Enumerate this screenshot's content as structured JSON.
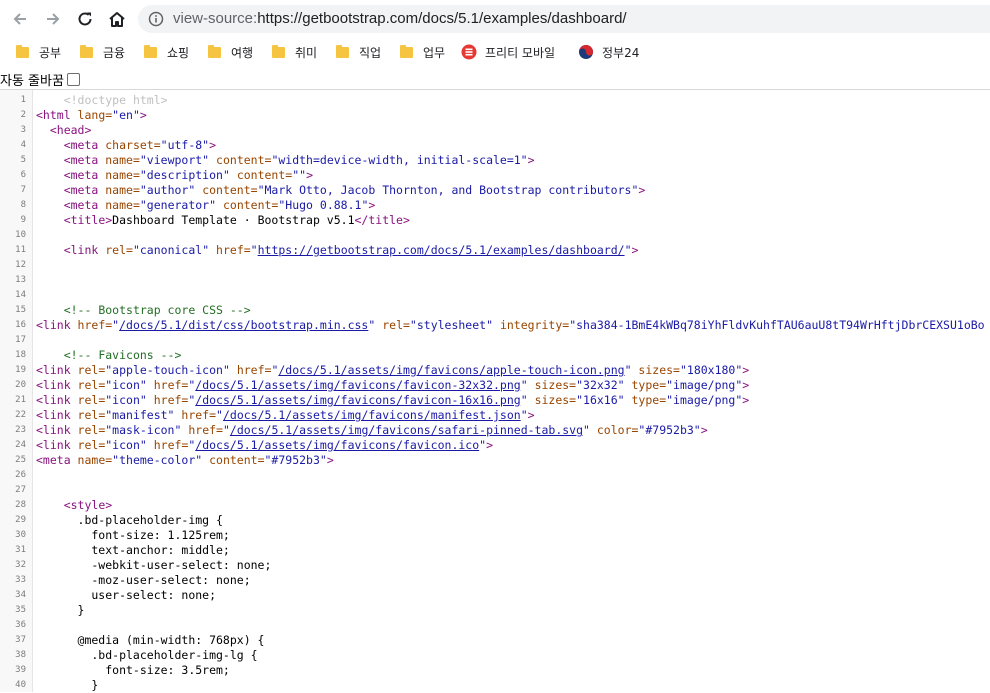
{
  "toolbar": {
    "scheme": "view-source:",
    "url_rest": "https://getbootstrap.com/docs/5.1/examples/dashboard/"
  },
  "bookmarks": [
    {
      "label": "공부",
      "icon": "folder-icon"
    },
    {
      "label": "금융",
      "icon": "folder-icon"
    },
    {
      "label": "쇼핑",
      "icon": "folder-icon"
    },
    {
      "label": "여행",
      "icon": "folder-icon"
    },
    {
      "label": "취미",
      "icon": "folder-icon"
    },
    {
      "label": "직업",
      "icon": "folder-icon"
    },
    {
      "label": "업무",
      "icon": "folder-icon"
    },
    {
      "label": "프리티 모바일",
      "icon": "pretty-mobile-icon"
    },
    {
      "label": "정부24",
      "icon": "korea-gov-icon"
    }
  ],
  "wrap_toggle": {
    "label": "자동 줄바꿈",
    "checked": false
  },
  "source": {
    "lines": [
      {
        "n": "1",
        "tokens": [
          {
            "t": "    ",
            "k": "p"
          },
          {
            "t": "<!doctype html>",
            "k": "d"
          }
        ]
      },
      {
        "n": "2",
        "tokens": [
          {
            "t": "<html ",
            "k": "t"
          },
          {
            "t": "lang=",
            "k": "a"
          },
          {
            "t": "\"en\"",
            "k": "v"
          },
          {
            "t": ">",
            "k": "t"
          }
        ]
      },
      {
        "n": "3",
        "tokens": [
          {
            "t": "  ",
            "k": "p"
          },
          {
            "t": "<head>",
            "k": "t"
          }
        ]
      },
      {
        "n": "4",
        "tokens": [
          {
            "t": "    ",
            "k": "p"
          },
          {
            "t": "<meta ",
            "k": "t"
          },
          {
            "t": "charset=",
            "k": "a"
          },
          {
            "t": "\"utf-8\"",
            "k": "v"
          },
          {
            "t": ">",
            "k": "t"
          }
        ]
      },
      {
        "n": "5",
        "tokens": [
          {
            "t": "    ",
            "k": "p"
          },
          {
            "t": "<meta ",
            "k": "t"
          },
          {
            "t": "name=",
            "k": "a"
          },
          {
            "t": "\"viewport\" ",
            "k": "v"
          },
          {
            "t": "content=",
            "k": "a"
          },
          {
            "t": "\"width=device-width, initial-scale=1\"",
            "k": "v"
          },
          {
            "t": ">",
            "k": "t"
          }
        ]
      },
      {
        "n": "6",
        "tokens": [
          {
            "t": "    ",
            "k": "p"
          },
          {
            "t": "<meta ",
            "k": "t"
          },
          {
            "t": "name=",
            "k": "a"
          },
          {
            "t": "\"description\" ",
            "k": "v"
          },
          {
            "t": "content=",
            "k": "a"
          },
          {
            "t": "\"\"",
            "k": "v"
          },
          {
            "t": ">",
            "k": "t"
          }
        ]
      },
      {
        "n": "7",
        "tokens": [
          {
            "t": "    ",
            "k": "p"
          },
          {
            "t": "<meta ",
            "k": "t"
          },
          {
            "t": "name=",
            "k": "a"
          },
          {
            "t": "\"author\" ",
            "k": "v"
          },
          {
            "t": "content=",
            "k": "a"
          },
          {
            "t": "\"Mark Otto, Jacob Thornton, and Bootstrap contributors\"",
            "k": "v"
          },
          {
            "t": ">",
            "k": "t"
          }
        ]
      },
      {
        "n": "8",
        "tokens": [
          {
            "t": "    ",
            "k": "p"
          },
          {
            "t": "<meta ",
            "k": "t"
          },
          {
            "t": "name=",
            "k": "a"
          },
          {
            "t": "\"generator\" ",
            "k": "v"
          },
          {
            "t": "content=",
            "k": "a"
          },
          {
            "t": "\"Hugo 0.88.1\"",
            "k": "v"
          },
          {
            "t": ">",
            "k": "t"
          }
        ]
      },
      {
        "n": "9",
        "tokens": [
          {
            "t": "    ",
            "k": "p"
          },
          {
            "t": "<title>",
            "k": "t"
          },
          {
            "t": "Dashboard Template · Bootstrap v5.1",
            "k": "p"
          },
          {
            "t": "</title>",
            "k": "t"
          }
        ]
      },
      {
        "n": "10",
        "tokens": []
      },
      {
        "n": "11",
        "tokens": [
          {
            "t": "    ",
            "k": "p"
          },
          {
            "t": "<link ",
            "k": "t"
          },
          {
            "t": "rel=",
            "k": "a"
          },
          {
            "t": "\"canonical\" ",
            "k": "v"
          },
          {
            "t": "href=",
            "k": "a"
          },
          {
            "t": "\"",
            "k": "v"
          },
          {
            "t": "https://getbootstrap.com/docs/5.1/examples/dashboard/",
            "k": "l"
          },
          {
            "t": "\"",
            "k": "v"
          },
          {
            "t": ">",
            "k": "t"
          }
        ]
      },
      {
        "n": "12",
        "tokens": []
      },
      {
        "n": "13",
        "tokens": []
      },
      {
        "n": "14",
        "tokens": []
      },
      {
        "n": "15",
        "tokens": [
          {
            "t": "    ",
            "k": "p"
          },
          {
            "t": "<!-- Bootstrap core CSS -->",
            "k": "c"
          }
        ]
      },
      {
        "n": "16",
        "tokens": [
          {
            "t": "<link ",
            "k": "t"
          },
          {
            "t": "href=",
            "k": "a"
          },
          {
            "t": "\"",
            "k": "v"
          },
          {
            "t": "/docs/5.1/dist/css/bootstrap.min.css",
            "k": "l"
          },
          {
            "t": "\" ",
            "k": "v"
          },
          {
            "t": "rel=",
            "k": "a"
          },
          {
            "t": "\"stylesheet\" ",
            "k": "v"
          },
          {
            "t": "integrity=",
            "k": "a"
          },
          {
            "t": "\"sha384-1BmE4kWBq78iYhFldvKuhfTAU6auU8tT94WrHftjDbrCEXSU1oBo",
            "k": "v"
          }
        ]
      },
      {
        "n": "17",
        "tokens": []
      },
      {
        "n": "18",
        "tokens": [
          {
            "t": "    ",
            "k": "p"
          },
          {
            "t": "<!-- Favicons -->",
            "k": "c"
          }
        ]
      },
      {
        "n": "19",
        "tokens": [
          {
            "t": "<link ",
            "k": "t"
          },
          {
            "t": "rel=",
            "k": "a"
          },
          {
            "t": "\"apple-touch-icon\" ",
            "k": "v"
          },
          {
            "t": "href=",
            "k": "a"
          },
          {
            "t": "\"",
            "k": "v"
          },
          {
            "t": "/docs/5.1/assets/img/favicons/apple-touch-icon.png",
            "k": "l"
          },
          {
            "t": "\" ",
            "k": "v"
          },
          {
            "t": "sizes=",
            "k": "a"
          },
          {
            "t": "\"180x180\"",
            "k": "v"
          },
          {
            "t": ">",
            "k": "t"
          }
        ]
      },
      {
        "n": "20",
        "tokens": [
          {
            "t": "<link ",
            "k": "t"
          },
          {
            "t": "rel=",
            "k": "a"
          },
          {
            "t": "\"icon\" ",
            "k": "v"
          },
          {
            "t": "href=",
            "k": "a"
          },
          {
            "t": "\"",
            "k": "v"
          },
          {
            "t": "/docs/5.1/assets/img/favicons/favicon-32x32.png",
            "k": "l"
          },
          {
            "t": "\" ",
            "k": "v"
          },
          {
            "t": "sizes=",
            "k": "a"
          },
          {
            "t": "\"32x32\" ",
            "k": "v"
          },
          {
            "t": "type=",
            "k": "a"
          },
          {
            "t": "\"image/png\"",
            "k": "v"
          },
          {
            "t": ">",
            "k": "t"
          }
        ]
      },
      {
        "n": "21",
        "tokens": [
          {
            "t": "<link ",
            "k": "t"
          },
          {
            "t": "rel=",
            "k": "a"
          },
          {
            "t": "\"icon\" ",
            "k": "v"
          },
          {
            "t": "href=",
            "k": "a"
          },
          {
            "t": "\"",
            "k": "v"
          },
          {
            "t": "/docs/5.1/assets/img/favicons/favicon-16x16.png",
            "k": "l"
          },
          {
            "t": "\" ",
            "k": "v"
          },
          {
            "t": "sizes=",
            "k": "a"
          },
          {
            "t": "\"16x16\" ",
            "k": "v"
          },
          {
            "t": "type=",
            "k": "a"
          },
          {
            "t": "\"image/png\"",
            "k": "v"
          },
          {
            "t": ">",
            "k": "t"
          }
        ]
      },
      {
        "n": "22",
        "tokens": [
          {
            "t": "<link ",
            "k": "t"
          },
          {
            "t": "rel=",
            "k": "a"
          },
          {
            "t": "\"manifest\" ",
            "k": "v"
          },
          {
            "t": "href=",
            "k": "a"
          },
          {
            "t": "\"",
            "k": "v"
          },
          {
            "t": "/docs/5.1/assets/img/favicons/manifest.json",
            "k": "l"
          },
          {
            "t": "\"",
            "k": "v"
          },
          {
            "t": ">",
            "k": "t"
          }
        ]
      },
      {
        "n": "23",
        "tokens": [
          {
            "t": "<link ",
            "k": "t"
          },
          {
            "t": "rel=",
            "k": "a"
          },
          {
            "t": "\"mask-icon\" ",
            "k": "v"
          },
          {
            "t": "href=",
            "k": "a"
          },
          {
            "t": "\"",
            "k": "v"
          },
          {
            "t": "/docs/5.1/assets/img/favicons/safari-pinned-tab.svg",
            "k": "l"
          },
          {
            "t": "\" ",
            "k": "v"
          },
          {
            "t": "color=",
            "k": "a"
          },
          {
            "t": "\"#7952b3\"",
            "k": "v"
          },
          {
            "t": ">",
            "k": "t"
          }
        ]
      },
      {
        "n": "24",
        "tokens": [
          {
            "t": "<link ",
            "k": "t"
          },
          {
            "t": "rel=",
            "k": "a"
          },
          {
            "t": "\"icon\" ",
            "k": "v"
          },
          {
            "t": "href=",
            "k": "a"
          },
          {
            "t": "\"",
            "k": "v"
          },
          {
            "t": "/docs/5.1/assets/img/favicons/favicon.ico",
            "k": "l"
          },
          {
            "t": "\"",
            "k": "v"
          },
          {
            "t": ">",
            "k": "t"
          }
        ]
      },
      {
        "n": "25",
        "tokens": [
          {
            "t": "<meta ",
            "k": "t"
          },
          {
            "t": "name=",
            "k": "a"
          },
          {
            "t": "\"theme-color\" ",
            "k": "v"
          },
          {
            "t": "content=",
            "k": "a"
          },
          {
            "t": "\"#7952b3\"",
            "k": "v"
          },
          {
            "t": ">",
            "k": "t"
          }
        ]
      },
      {
        "n": "26",
        "tokens": []
      },
      {
        "n": "27",
        "tokens": []
      },
      {
        "n": "28",
        "tokens": [
          {
            "t": "    ",
            "k": "p"
          },
          {
            "t": "<style>",
            "k": "t"
          }
        ]
      },
      {
        "n": "29",
        "tokens": [
          {
            "t": "      .bd-placeholder-img {",
            "k": "p"
          }
        ]
      },
      {
        "n": "30",
        "tokens": [
          {
            "t": "        font-size: 1.125rem;",
            "k": "p"
          }
        ]
      },
      {
        "n": "31",
        "tokens": [
          {
            "t": "        text-anchor: middle;",
            "k": "p"
          }
        ]
      },
      {
        "n": "32",
        "tokens": [
          {
            "t": "        -webkit-user-select: none;",
            "k": "p"
          }
        ]
      },
      {
        "n": "33",
        "tokens": [
          {
            "t": "        -moz-user-select: none;",
            "k": "p"
          }
        ]
      },
      {
        "n": "34",
        "tokens": [
          {
            "t": "        user-select: none;",
            "k": "p"
          }
        ]
      },
      {
        "n": "35",
        "tokens": [
          {
            "t": "      }",
            "k": "p"
          }
        ]
      },
      {
        "n": "36",
        "tokens": []
      },
      {
        "n": "37",
        "tokens": [
          {
            "t": "      @media (min-width: 768px) {",
            "k": "p"
          }
        ]
      },
      {
        "n": "38",
        "tokens": [
          {
            "t": "        .bd-placeholder-img-lg {",
            "k": "p"
          }
        ]
      },
      {
        "n": "39",
        "tokens": [
          {
            "t": "          font-size: 3.5rem;",
            "k": "p"
          }
        ]
      },
      {
        "n": "40",
        "tokens": [
          {
            "t": "        }",
            "k": "p"
          }
        ]
      }
    ]
  },
  "colors": {
    "tag": "#881280",
    "attr": "#994500",
    "value": "#1a1aa6",
    "comment": "#236e25",
    "doctype": "#c0c0c0",
    "bookmark_folder": "#f5c542"
  }
}
